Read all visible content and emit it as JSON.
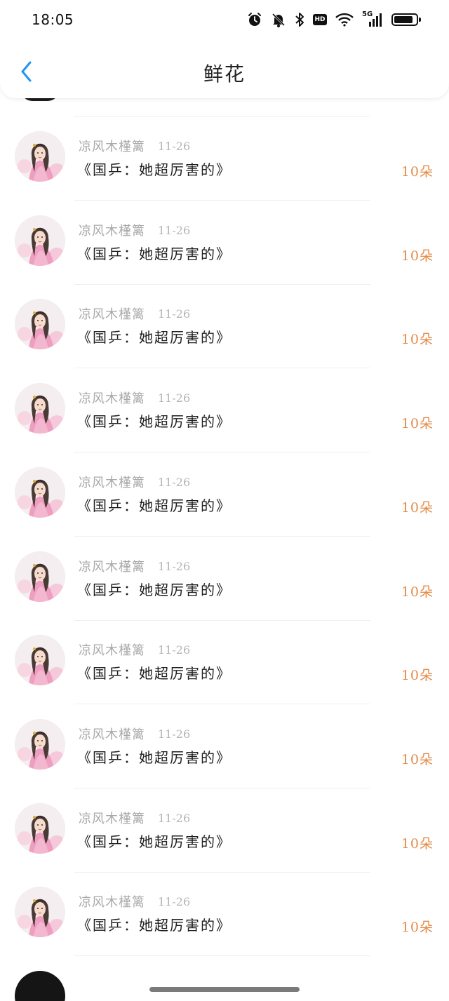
{
  "status_bar": {
    "time": "18:05",
    "network": "5G",
    "hd_label": "HD"
  },
  "header": {
    "title": "鲜花"
  },
  "items": [
    {
      "name": "凉风木槿篱",
      "date": "11-26",
      "book": "《国乒：她超厉害的》",
      "count": "10朵"
    },
    {
      "name": "凉风木槿篱",
      "date": "11-26",
      "book": "《国乒：她超厉害的》",
      "count": "10朵"
    },
    {
      "name": "凉风木槿篱",
      "date": "11-26",
      "book": "《国乒：她超厉害的》",
      "count": "10朵"
    },
    {
      "name": "凉风木槿篱",
      "date": "11-26",
      "book": "《国乒：她超厉害的》",
      "count": "10朵"
    },
    {
      "name": "凉风木槿篱",
      "date": "11-26",
      "book": "《国乒：她超厉害的》",
      "count": "10朵"
    },
    {
      "name": "凉风木槿篱",
      "date": "11-26",
      "book": "《国乒：她超厉害的》",
      "count": "10朵"
    },
    {
      "name": "凉风木槿篱",
      "date": "11-26",
      "book": "《国乒：她超厉害的》",
      "count": "10朵"
    },
    {
      "name": "凉风木槿篱",
      "date": "11-26",
      "book": "《国乒：她超厉害的》",
      "count": "10朵"
    },
    {
      "name": "凉风木槿篱",
      "date": "11-26",
      "book": "《国乒：她超厉害的》",
      "count": "10朵"
    },
    {
      "name": "凉风木槿篱",
      "date": "11-26",
      "book": "《国乒：她超厉害的》",
      "count": "10朵"
    }
  ],
  "colors": {
    "accent": "#2196f3",
    "count": "#e58a48",
    "meta": "#a9a9a9"
  },
  "icons": [
    "alarm-icon",
    "mute-bell-icon",
    "bluetooth-icon",
    "hd-icon",
    "wifi-icon",
    "signal-5g-icon",
    "battery-icon",
    "back-arrow-icon"
  ]
}
